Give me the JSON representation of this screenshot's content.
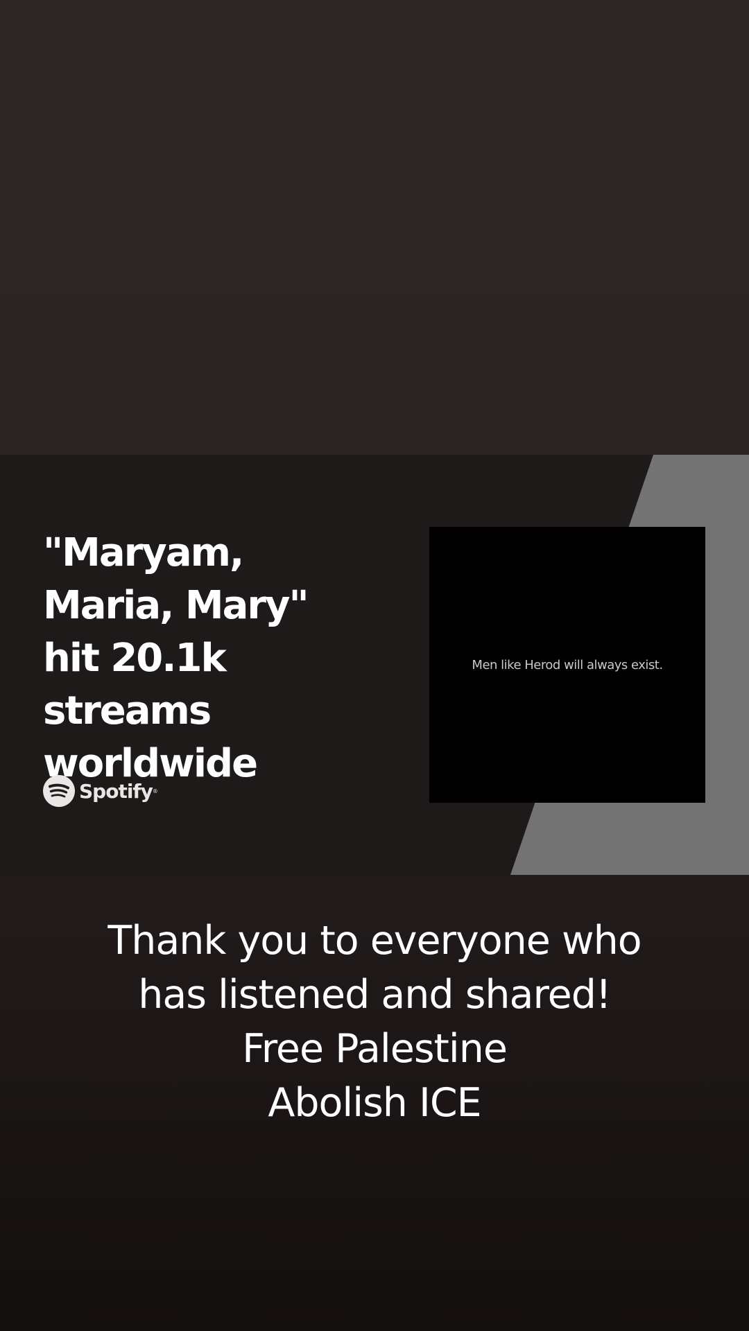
{
  "story_card": {
    "headline": "\"Maryam, Maria, Mary\" hit 20.1k streams worldwide",
    "brand": {
      "icon": "spotify-icon",
      "name": "Spotify",
      "trademark": "®"
    },
    "cover_art": {
      "text": "Men like Herod will always exist."
    },
    "colors": {
      "card_background": "#1e1a1a",
      "stripe": "#737373",
      "cover_background": "#000000"
    }
  },
  "caption": {
    "lines": [
      "Thank you to everyone who",
      "has listened and shared!",
      "Free Palestine",
      "Abolish ICE"
    ]
  }
}
